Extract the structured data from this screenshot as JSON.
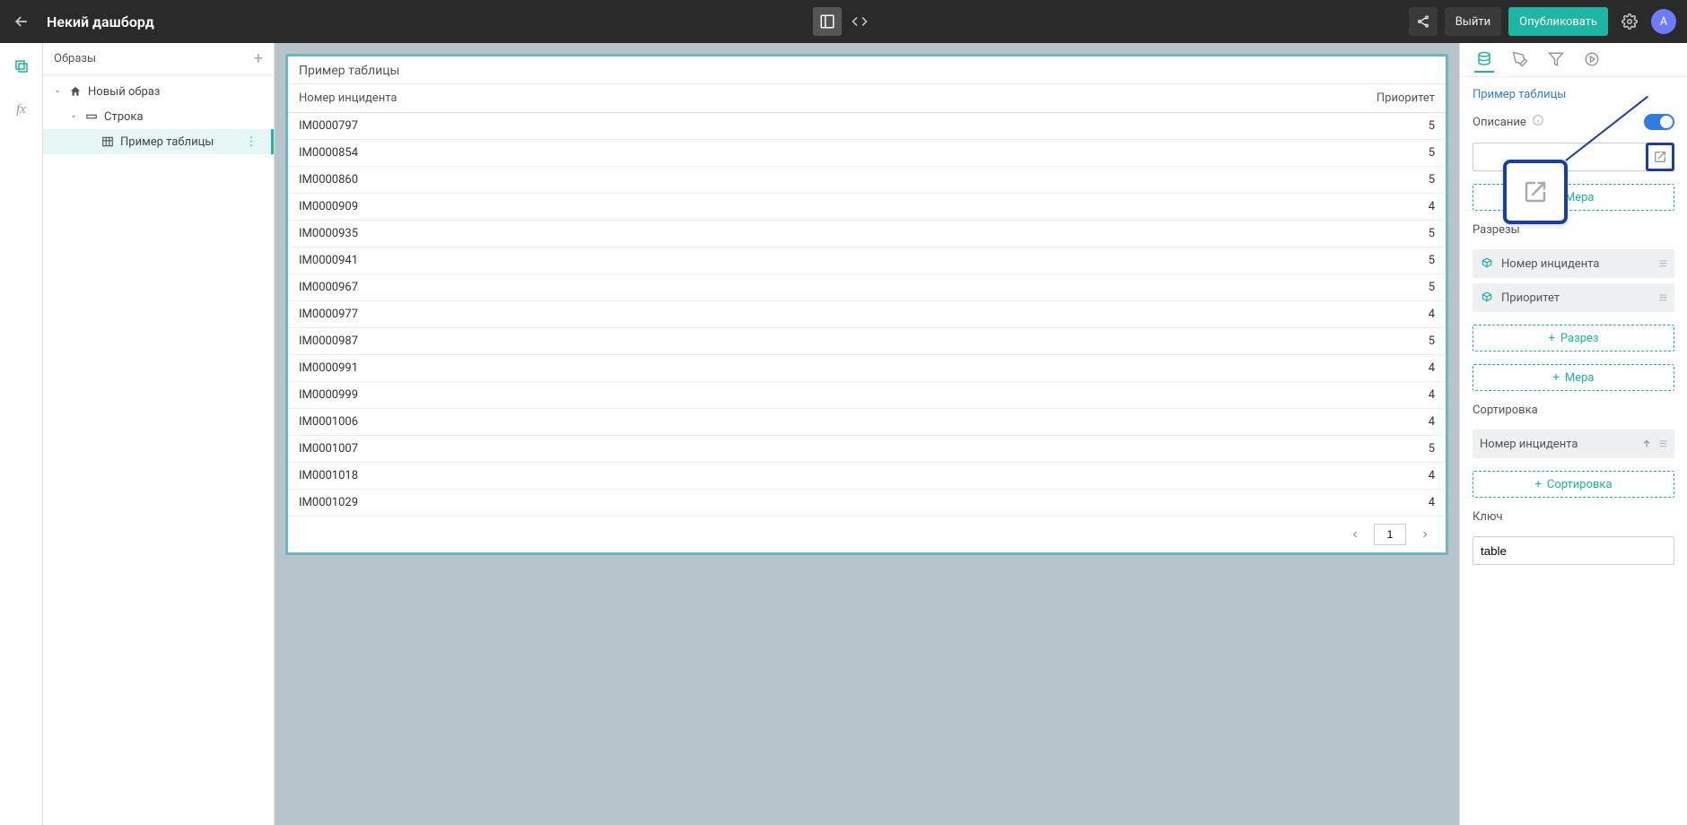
{
  "header": {
    "title": "Некий дашборд",
    "logout": "Выйти",
    "publish": "Опубликовать",
    "avatar_letter": "A"
  },
  "tree": {
    "panel_title": "Образы",
    "items": {
      "root": "Новый образ",
      "row": "Строка",
      "table": "Пример таблицы"
    }
  },
  "widget": {
    "title": "Пример таблицы",
    "columns": {
      "col1": "Номер инцидента",
      "col2": "Приоритет"
    },
    "rows": [
      {
        "c1": "IM0000797",
        "c2": "5"
      },
      {
        "c1": "IM0000854",
        "c2": "5"
      },
      {
        "c1": "IM0000860",
        "c2": "5"
      },
      {
        "c1": "IM0000909",
        "c2": "4"
      },
      {
        "c1": "IM0000935",
        "c2": "5"
      },
      {
        "c1": "IM0000941",
        "c2": "5"
      },
      {
        "c1": "IM0000967",
        "c2": "5"
      },
      {
        "c1": "IM0000977",
        "c2": "4"
      },
      {
        "c1": "IM0000987",
        "c2": "5"
      },
      {
        "c1": "IM0000991",
        "c2": "4"
      },
      {
        "c1": "IM0000999",
        "c2": "4"
      },
      {
        "c1": "IM0001006",
        "c2": "4"
      },
      {
        "c1": "IM0001007",
        "c2": "5"
      },
      {
        "c1": "IM0001018",
        "c2": "4"
      },
      {
        "c1": "IM0001029",
        "c2": "4"
      }
    ],
    "pager": {
      "page": "1"
    }
  },
  "props": {
    "breadcrumb": "Пример таблицы",
    "description_label": "Описание",
    "mera_label": "Мера",
    "razrezy_label": "Разрезы",
    "razrez_btn": "Разрез",
    "razrez_items": {
      "r0": "Номер инцидента",
      "r1": "Приоритет"
    },
    "sort_label": "Сортировка",
    "sort_item": "Номер инцидента",
    "sort_btn": "Сортировка",
    "key_label": "Ключ",
    "key_value": "table"
  }
}
